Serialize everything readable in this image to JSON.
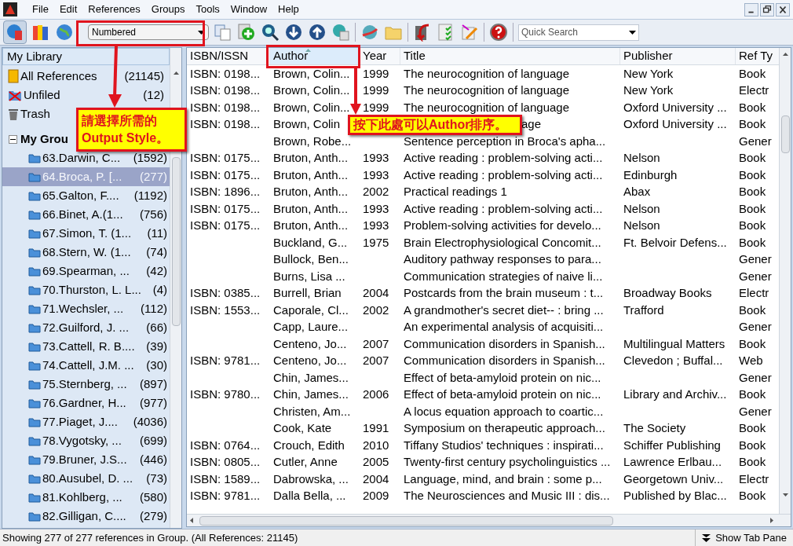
{
  "menu": [
    "File",
    "Edit",
    "References",
    "Groups",
    "Tools",
    "Window",
    "Help"
  ],
  "style_select": {
    "value": "Numbered"
  },
  "quick_search": {
    "placeholder": "Quick Search"
  },
  "library": {
    "header": "My Library",
    "items": [
      {
        "kind": "all",
        "label": "All References",
        "count": "(21145)"
      },
      {
        "kind": "unfiled",
        "label": "Unfiled",
        "count": "(12)"
      },
      {
        "kind": "trash",
        "label": "Trash"
      }
    ],
    "groups_header": {
      "label": "My Grou",
      "expanded": true
    },
    "groups": [
      {
        "label": "63.Darwin, C...",
        "count": "(1592)",
        "selected": false
      },
      {
        "label": "64.Broca, P. [...",
        "count": "(277)",
        "selected": true
      },
      {
        "label": "65.Galton, F....",
        "count": "(1192)",
        "selected": false
      },
      {
        "label": "66.Binet, A.(1...",
        "count": "(756)",
        "selected": false
      },
      {
        "label": "67.Simon, T. (1...",
        "count": "(11)",
        "selected": false
      },
      {
        "label": "68.Stern, W. (1...",
        "count": "(74)",
        "selected": false
      },
      {
        "label": "69.Spearman, ...",
        "count": "(42)",
        "selected": false
      },
      {
        "label": "70.Thurston, L. L...",
        "count": "(4)",
        "selected": false
      },
      {
        "label": "71.Wechsler, ...",
        "count": "(112)",
        "selected": false
      },
      {
        "label": "72.Guilford, J. ...",
        "count": "(66)",
        "selected": false
      },
      {
        "label": "73.Cattell, R. B....",
        "count": "(39)",
        "selected": false
      },
      {
        "label": "74.Cattell, J.M. ...",
        "count": "(30)",
        "selected": false
      },
      {
        "label": "75.Sternberg, ...",
        "count": "(897)",
        "selected": false
      },
      {
        "label": "76.Gardner, H...",
        "count": "(977)",
        "selected": false
      },
      {
        "label": "77.Piaget, J....",
        "count": "(4036)",
        "selected": false
      },
      {
        "label": "78.Vygotsky, ...",
        "count": "(699)",
        "selected": false
      },
      {
        "label": "79.Bruner, J.S...",
        "count": "(446)",
        "selected": false
      },
      {
        "label": "80.Ausubel, D. ...",
        "count": "(73)",
        "selected": false
      },
      {
        "label": "81.Kohlberg, ...",
        "count": "(580)",
        "selected": false
      },
      {
        "label": "82.Gilligan, C....",
        "count": "(279)",
        "selected": false
      }
    ]
  },
  "table": {
    "columns": [
      {
        "label": "ISBN/ISSN",
        "sorted": false
      },
      {
        "label": "Author",
        "sorted": true
      },
      {
        "label": "Year",
        "sorted": false
      },
      {
        "label": "Title",
        "sorted": false
      },
      {
        "label": "Publisher",
        "sorted": false
      },
      {
        "label": "Ref Ty",
        "sorted": false
      }
    ],
    "rows": [
      {
        "kind": "full",
        "cells": [
          "ISBN: 0198...",
          "Brown, Colin...",
          "1999",
          "The neurocognition of language",
          "New York",
          "Book"
        ]
      },
      {
        "kind": "full",
        "cells": [
          "ISBN: 0198...",
          "Brown, Colin...",
          "1999",
          "The neurocognition of language",
          "New York",
          "Electr"
        ]
      },
      {
        "kind": "full",
        "cells": [
          "ISBN: 0198...",
          "Brown, Colin...",
          "1999",
          "The neurocognition of language",
          "Oxford University ...",
          "Book"
        ]
      },
      {
        "kind": "tail",
        "cells": [
          "ISBN: 0198...",
          "Brown, Colin",
          null,
          "age",
          "Oxford University ...",
          "Book"
        ]
      },
      {
        "kind": "full",
        "cells": [
          null,
          "Brown, Robe...",
          null,
          "Sentence perception in Broca's apha...",
          null,
          "Gener"
        ]
      },
      {
        "kind": "full",
        "cells": [
          "ISBN: 0175...",
          "Bruton, Anth...",
          "1993",
          "Active reading : problem-solving acti...",
          "Nelson",
          "Book"
        ]
      },
      {
        "kind": "full",
        "cells": [
          "ISBN: 0175...",
          "Bruton, Anth...",
          "1993",
          "Active reading : problem-solving acti...",
          "Edinburgh",
          "Book"
        ]
      },
      {
        "kind": "full",
        "cells": [
          "ISBN: 1896...",
          "Bruton, Anth...",
          "2002",
          "Practical readings 1",
          "Abax",
          "Book"
        ]
      },
      {
        "kind": "full",
        "cells": [
          "ISBN: 0175...",
          "Bruton, Anth...",
          "1993",
          "Active reading : problem-solving acti...",
          "Nelson",
          "Book"
        ]
      },
      {
        "kind": "full",
        "cells": [
          "ISBN: 0175...",
          "Bruton, Anth...",
          "1993",
          "Problem-solving activities for develo...",
          "Nelson",
          "Book"
        ]
      },
      {
        "kind": "full",
        "cells": [
          null,
          "Buckland, G...",
          "1975",
          "Brain Electrophysiological Concomit...",
          "Ft. Belvoir Defens...",
          "Book"
        ]
      },
      {
        "kind": "full",
        "cells": [
          null,
          "Bullock, Ben...",
          null,
          "Auditory pathway responses to para...",
          null,
          "Gener"
        ]
      },
      {
        "kind": "full",
        "cells": [
          null,
          "Burns, Lisa ...",
          null,
          "Communication strategies of naive li...",
          null,
          "Gener"
        ]
      },
      {
        "kind": "full",
        "cells": [
          "ISBN: 0385...",
          "Burrell, Brian",
          "2004",
          "Postcards from the brain museum : t...",
          "Broadway Books",
          "Electr"
        ]
      },
      {
        "kind": "full",
        "cells": [
          "ISBN: 1553...",
          "Caporale, Cl...",
          "2002",
          "A grandmother's secret diet-- : bring ...",
          "Trafford",
          "Book"
        ]
      },
      {
        "kind": "full",
        "cells": [
          null,
          "Capp, Laure...",
          null,
          "An experimental analysis of acquisiti...",
          null,
          "Gener"
        ]
      },
      {
        "kind": "full",
        "cells": [
          null,
          "Centeno, Jo...",
          "2007",
          "Communication disorders in Spanish...",
          "Multilingual Matters",
          "Book"
        ]
      },
      {
        "kind": "full",
        "cells": [
          "ISBN: 9781...",
          "Centeno, Jo...",
          "2007",
          "Communication disorders in Spanish...",
          "Clevedon ; Buffal...",
          "Web"
        ]
      },
      {
        "kind": "full",
        "cells": [
          null,
          "Chin, James...",
          null,
          "Effect of beta-amyloid protein on nic...",
          null,
          "Gener"
        ]
      },
      {
        "kind": "full",
        "cells": [
          "ISBN: 9780...",
          "Chin, James...",
          "2006",
          "Effect of beta-amyloid protein on nic...",
          "Library and Archiv...",
          "Book"
        ]
      },
      {
        "kind": "full",
        "cells": [
          null,
          "Christen, Am...",
          null,
          "A locus equation approach to coartic...",
          null,
          "Gener"
        ]
      },
      {
        "kind": "full",
        "cells": [
          null,
          "Cook, Kate",
          "1991",
          "Symposium on therapeutic approach...",
          "The Society",
          "Book"
        ]
      },
      {
        "kind": "full",
        "cells": [
          "ISBN: 0764...",
          "Crouch, Edith",
          "2010",
          "Tiffany Studios' techniques : inspirati...",
          "Schiffer Publishing",
          "Book"
        ]
      },
      {
        "kind": "full",
        "cells": [
          "ISBN: 0805...",
          "Cutler, Anne",
          "2005",
          "Twenty-first century psycholinguistics ...",
          "Lawrence Erlbau...",
          "Book"
        ]
      },
      {
        "kind": "full",
        "cells": [
          "ISBN: 1589...",
          "Dabrowska, ...",
          "2004",
          "Language, mind, and brain : some p...",
          "Georgetown Univ...",
          "Electr"
        ]
      },
      {
        "kind": "full",
        "cells": [
          "ISBN: 9781...",
          "Dalla Bella, ...",
          "2009",
          "The Neurosciences and Music III : dis...",
          "Published by Blac...",
          "Book"
        ]
      }
    ]
  },
  "status": {
    "text": "Showing 277 of 277 references in Group. (All References: 21145)",
    "toggle": "Show Tab Pane"
  },
  "callouts": [
    {
      "text": "請選擇所需的**Output Style**。"
    },
    {
      "text": "按下此處可以**Author**排序。"
    }
  ]
}
